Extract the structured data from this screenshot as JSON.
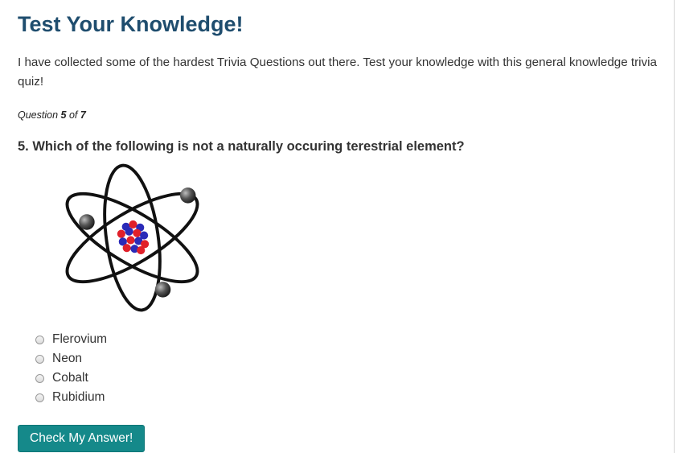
{
  "quiz": {
    "title": "Test Your Knowledge!",
    "intro": "I have collected some of the hardest Trivia Questions out there. Test your knowledge with this general knowledge trivia quiz!",
    "progress": {
      "prefix": "Question",
      "current": "5",
      "separator": "of",
      "total": "7"
    },
    "question": "5. Which of the following is not a naturally occuring terestrial element?",
    "image_icon": "atom-icon",
    "options": [
      {
        "label": "Flerovium",
        "selected": false
      },
      {
        "label": "Neon",
        "selected": false
      },
      {
        "label": "Cobalt",
        "selected": false
      },
      {
        "label": "Rubidium",
        "selected": false
      }
    ],
    "submit_label": "Check My Answer!"
  },
  "colors": {
    "title": "#1f4d6e",
    "button": "#15898a",
    "proton": "#e0202a",
    "neutron": "#2a2ab8",
    "electron": "#555555"
  }
}
